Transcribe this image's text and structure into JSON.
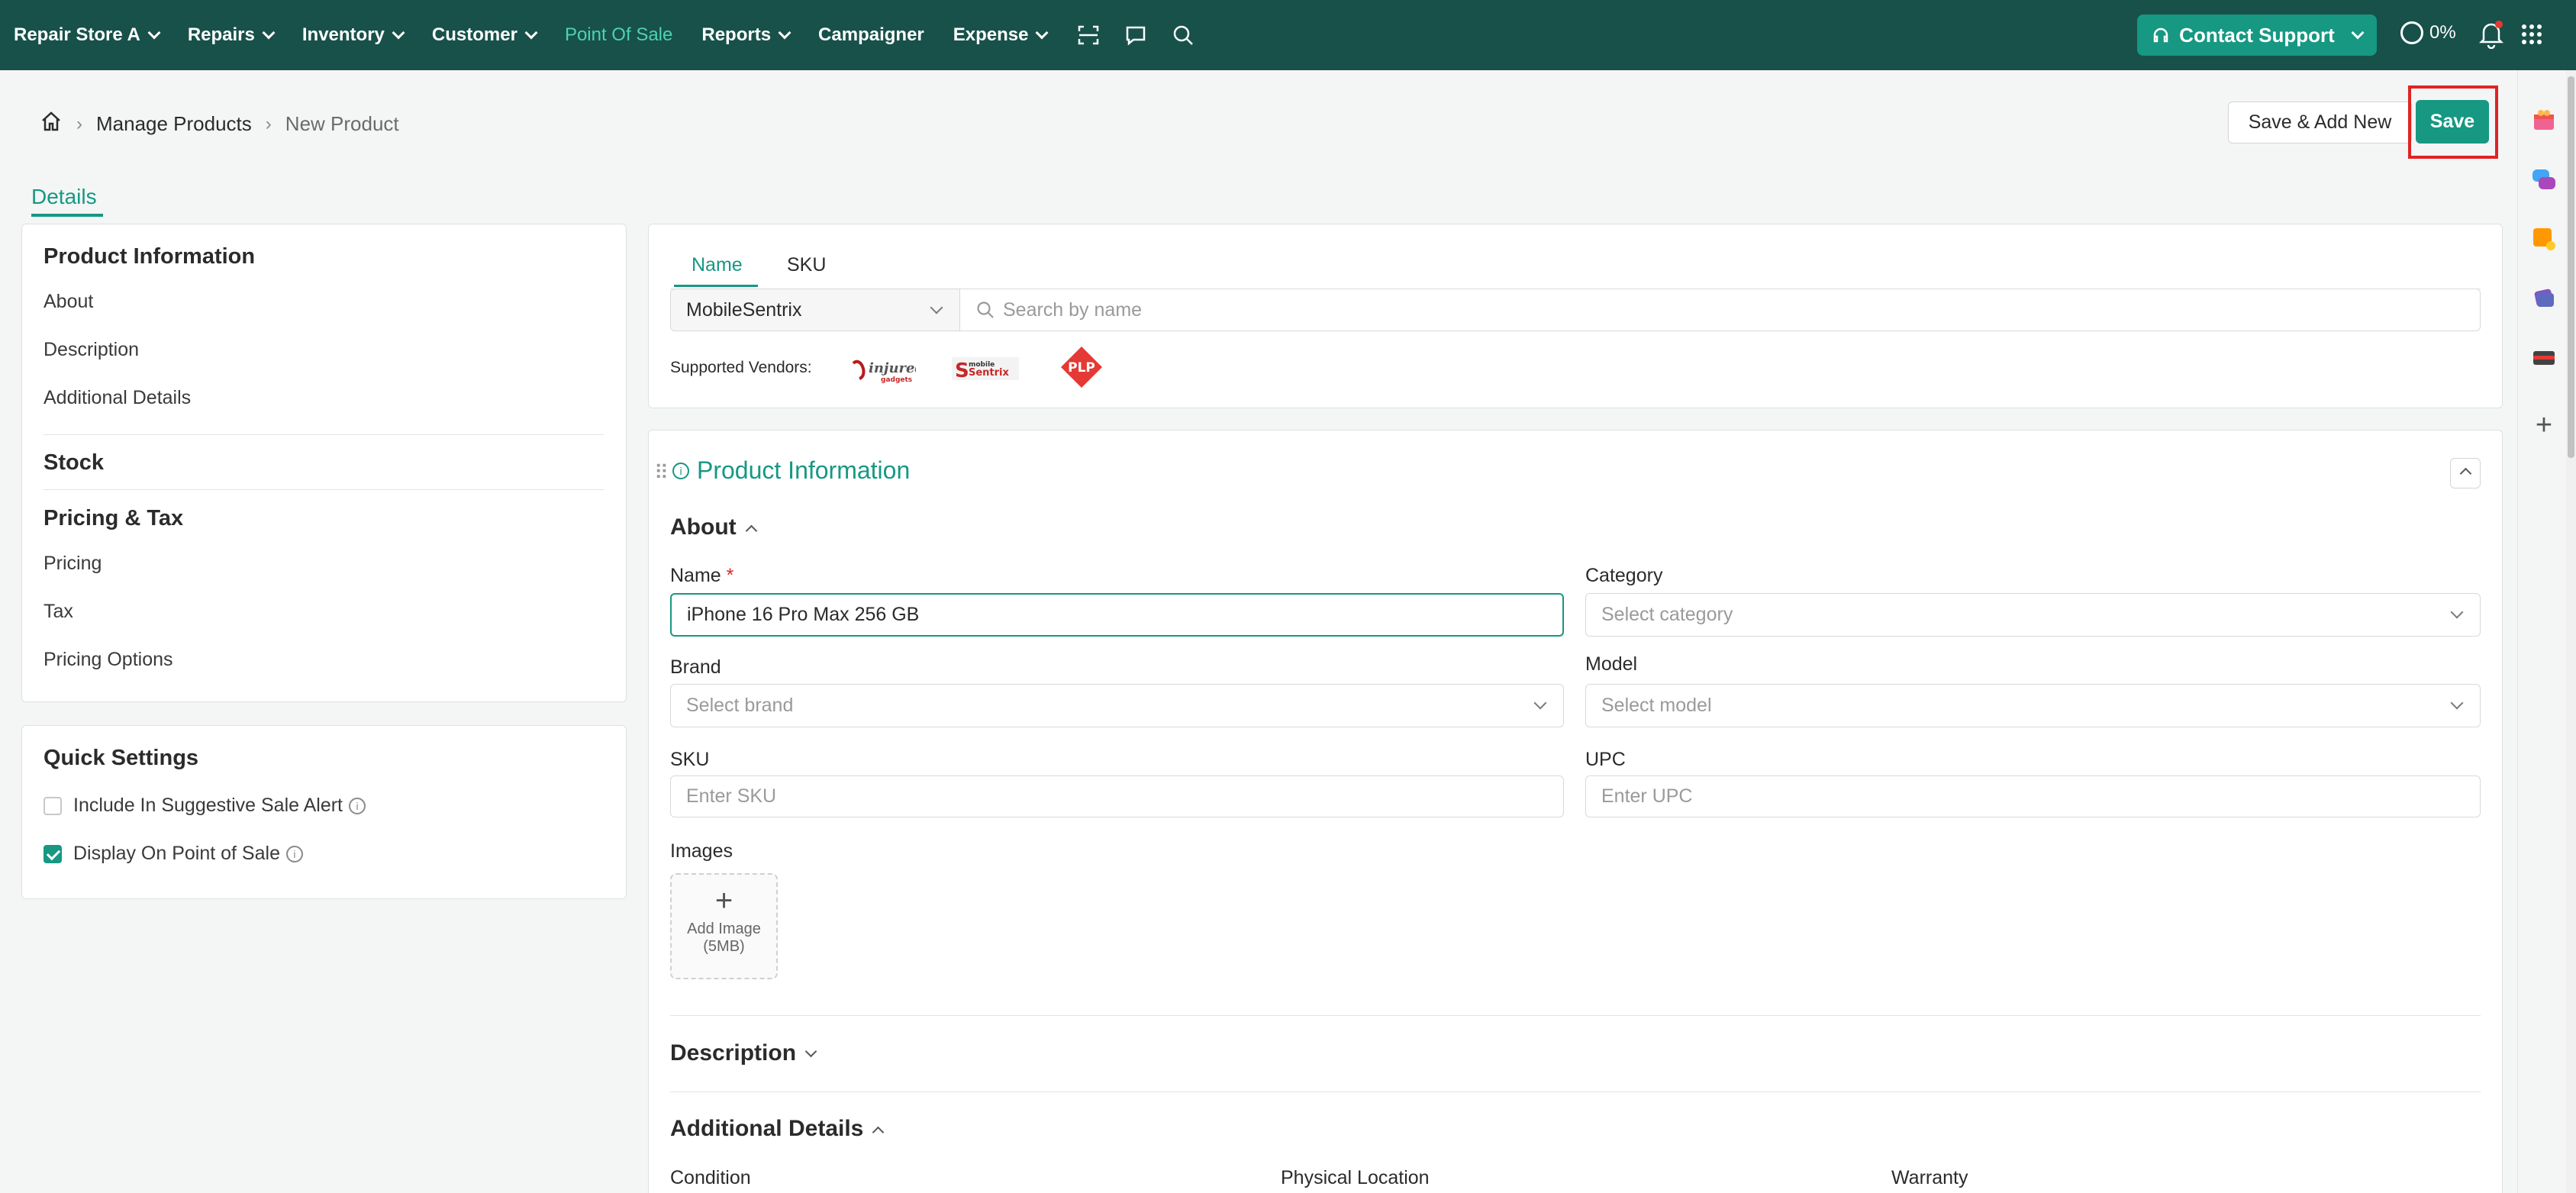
{
  "nav": {
    "store": "Repair Store A",
    "items": [
      "Repairs",
      "Inventory",
      "Customer",
      "Point Of Sale",
      "Reports",
      "Campaigner",
      "Expense"
    ],
    "support": "Contact Support",
    "progress": "0%"
  },
  "breadcrumb": {
    "level1": "Manage Products",
    "current": "New Product"
  },
  "actions": {
    "save_add_new": "Save & Add New",
    "save": "Save"
  },
  "tabs": {
    "details": "Details"
  },
  "sidebar": {
    "product_information": "Product Information",
    "items_pi": [
      "About",
      "Description",
      "Additional Details"
    ],
    "stock": "Stock",
    "pricing_tax": "Pricing & Tax",
    "items_pt": [
      "Pricing",
      "Tax",
      "Pricing Options"
    ],
    "quick_settings": "Quick Settings",
    "qs_suggestive": "Include In Suggestive Sale Alert",
    "qs_suggestive_checked": false,
    "qs_pos": "Display On Point of Sale",
    "qs_pos_checked": true
  },
  "search": {
    "tab_name": "Name",
    "tab_sku": "SKU",
    "vendor_select": "MobileSentrix",
    "placeholder": "Search by name",
    "supported_vendors": "Supported Vendors:",
    "vendors": [
      "injured gadgets",
      "mobile sentrix",
      "PLP"
    ]
  },
  "product_info": {
    "title": "Product Information",
    "about": "About",
    "name_label": "Name",
    "name_value": "iPhone 16 Pro Max 256 GB",
    "category_label": "Category",
    "category_placeholder": "Select category",
    "brand_label": "Brand",
    "brand_placeholder": "Select brand",
    "model_label": "Model",
    "model_placeholder": "Select model",
    "sku_label": "SKU",
    "sku_placeholder": "Enter SKU",
    "upc_label": "UPC",
    "upc_placeholder": "Enter UPC",
    "images_label": "Images",
    "add_image": "Add Image",
    "add_image_size": "(5MB)",
    "description": "Description",
    "additional_details": "Additional Details",
    "condition": "Condition",
    "physical_location": "Physical Location",
    "warranty": "Warranty"
  },
  "colors": {
    "header": "#17514a",
    "accent": "#169883",
    "highlight": "#e02424"
  }
}
